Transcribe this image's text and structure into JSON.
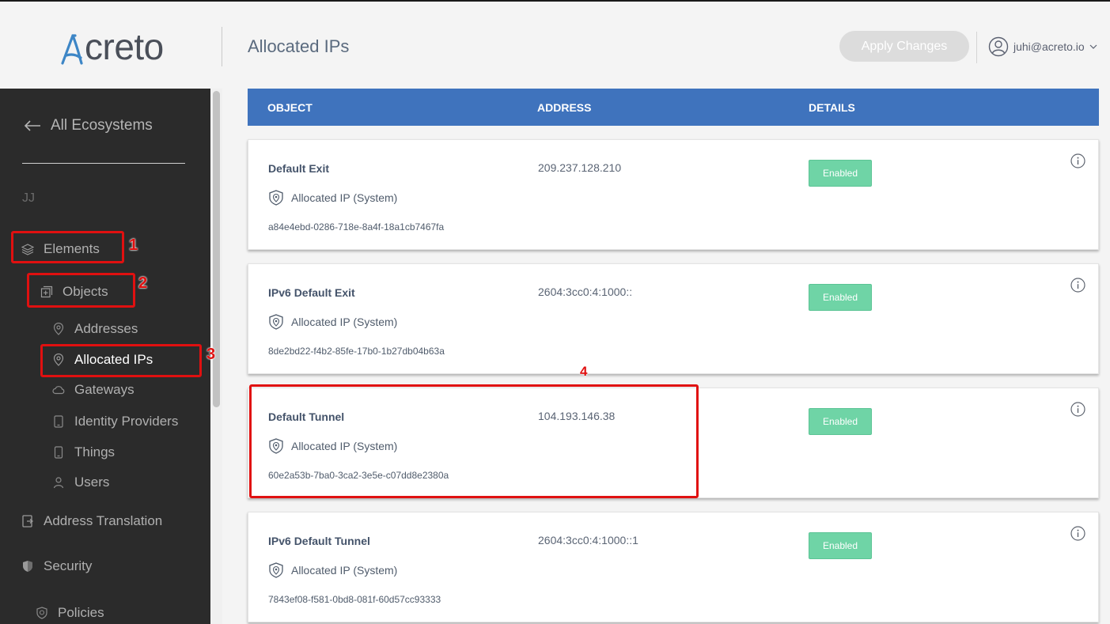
{
  "header": {
    "logo_text": "creto",
    "page_title": "Allocated IPs",
    "apply_button": "Apply Changes",
    "user_email": "juhi@acreto.io",
    "icons": [
      "acreto-logo",
      "user-avatar-icon",
      "chevron-down-icon"
    ]
  },
  "sidebar": {
    "back_label": "All Ecosystems",
    "ecosystem": "JJ",
    "items": [
      {
        "label": "Elements",
        "icon": "layers-icon"
      },
      {
        "label": "Objects",
        "icon": "objects-icon"
      },
      {
        "label": "Addresses",
        "icon": "location-pin-icon"
      },
      {
        "label": "Allocated IPs",
        "icon": "location-pin-icon"
      },
      {
        "label": "Gateways",
        "icon": "cloud-icon"
      },
      {
        "label": "Identity Providers",
        "icon": "tablet-icon"
      },
      {
        "label": "Things",
        "icon": "phone-icon"
      },
      {
        "label": "Users",
        "icon": "user-icon"
      },
      {
        "label": "Address Translation",
        "icon": "nat-icon"
      },
      {
        "label": "Security",
        "icon": "shield-icon"
      },
      {
        "label": "Policies",
        "icon": "policy-shield-icon"
      }
    ],
    "active_item": "Allocated IPs"
  },
  "annotations": [
    "1",
    "2",
    "3",
    "4"
  ],
  "table": {
    "headers": [
      "OBJECT",
      "ADDRESS",
      "DETAILS"
    ],
    "rows": [
      {
        "name": "Default Exit",
        "type": "Allocated IP (System)",
        "id": "a84e4ebd-0286-718e-8a4f-18a1cb7467fa",
        "address": "209.237.128.210",
        "status": "Enabled"
      },
      {
        "name": "IPv6 Default Exit",
        "type": "Allocated IP (System)",
        "id": "8de2bd22-f4b2-85fe-17b0-1b27db04b63a",
        "address": "2604:3cc0:4:1000::",
        "status": "Enabled"
      },
      {
        "name": "Default Tunnel",
        "type": "Allocated IP (System)",
        "id": "60e2a53b-7ba0-3ca2-3e5e-c07dd8e2380a",
        "address": "104.193.146.38",
        "status": "Enabled"
      },
      {
        "name": "IPv6 Default Tunnel",
        "type": "Allocated IP (System)",
        "id": "7843ef08-f581-0bd8-081f-60d57cc93333",
        "address": "2604:3cc0:4:1000::1",
        "status": "Enabled"
      }
    ]
  },
  "colors": {
    "sidebar_bg": "#2b2b2b",
    "table_header": "#3f73bd",
    "badge_enabled": "#6fd4a6",
    "annotation": "#e01010"
  }
}
